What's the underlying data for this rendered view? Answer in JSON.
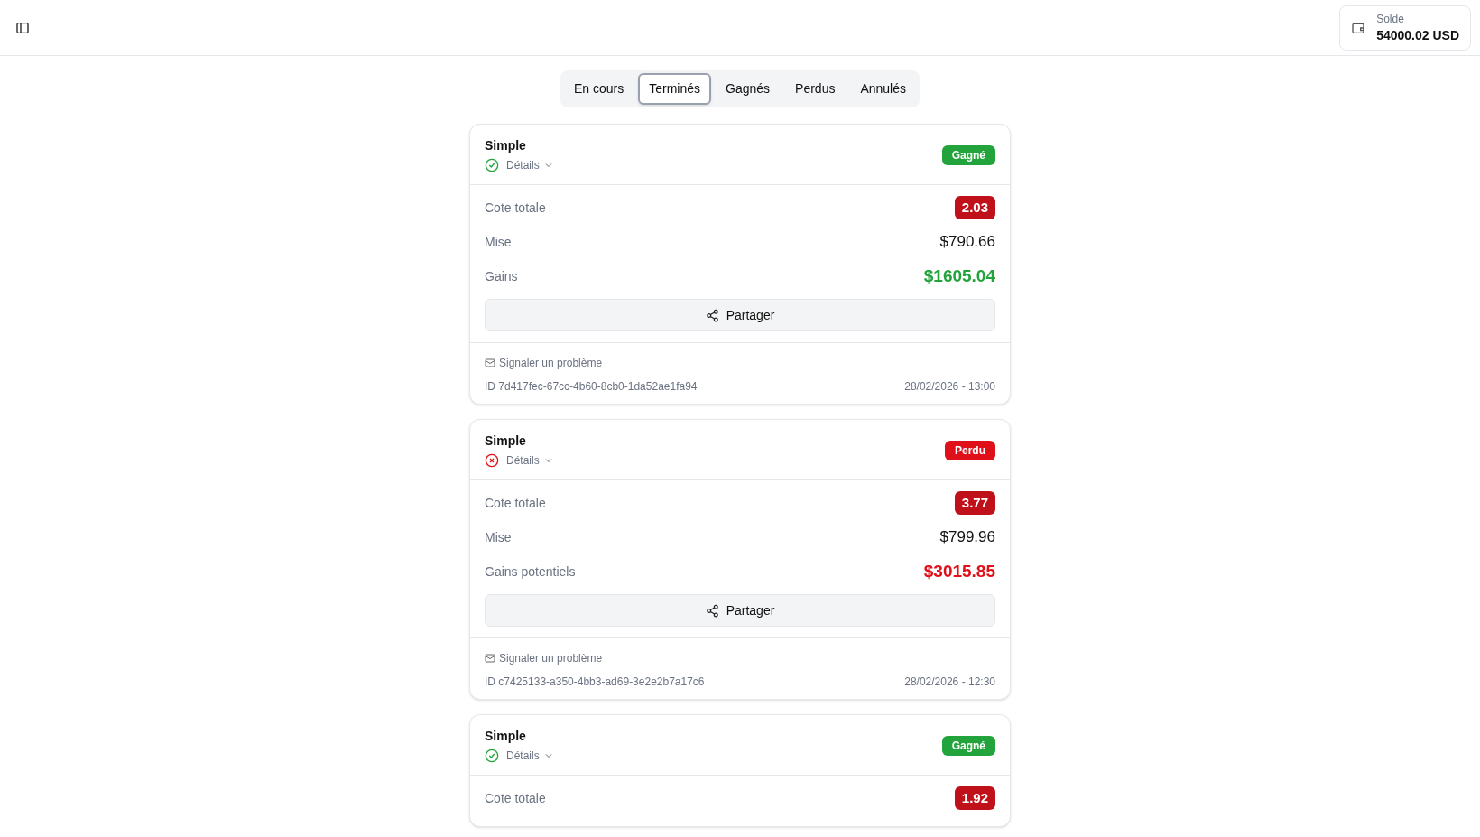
{
  "balance": {
    "label": "Solde",
    "value": "54000.02 USD"
  },
  "tabs": [
    {
      "label": "En cours",
      "selected": false
    },
    {
      "label": "Terminés",
      "selected": true
    },
    {
      "label": "Gagnés",
      "selected": false
    },
    {
      "label": "Perdus",
      "selected": false
    },
    {
      "label": "Annulés",
      "selected": false
    }
  ],
  "bets": [
    {
      "title": "Simple",
      "details": "Détails",
      "won": true,
      "badge": "Gagné",
      "rows": [
        {
          "kind": "odds",
          "label": "Cote totale",
          "value": "2.03"
        },
        {
          "kind": "stake",
          "label": "Mise",
          "value": "$790.66"
        },
        {
          "kind": "gain",
          "label": "Gains",
          "value": "$1605.04"
        }
      ],
      "share": "Partager",
      "report": "Signaler un problème",
      "id": "ID 7d417fec-67cc-4b60-8cb0-1da52ae1fa94",
      "date": "28/02/2026 - 13:00"
    },
    {
      "title": "Simple",
      "details": "Détails",
      "won": false,
      "badge": "Perdu",
      "rows": [
        {
          "kind": "odds",
          "label": "Cote totale",
          "value": "3.77"
        },
        {
          "kind": "stake",
          "label": "Mise",
          "value": "$799.96"
        },
        {
          "kind": "gain",
          "label": "Gains potentiels",
          "value": "$3015.85"
        }
      ],
      "share": "Partager",
      "report": "Signaler un problème",
      "id": "ID c7425133-a350-4bb3-ad69-3e2e2b7a17c6",
      "date": "28/02/2026 - 12:30"
    },
    {
      "title": "Simple",
      "details": "Détails",
      "won": true,
      "badge": "Gagné",
      "rows": [
        {
          "kind": "odds",
          "label": "Cote totale",
          "value": "1.92"
        }
      ]
    }
  ]
}
